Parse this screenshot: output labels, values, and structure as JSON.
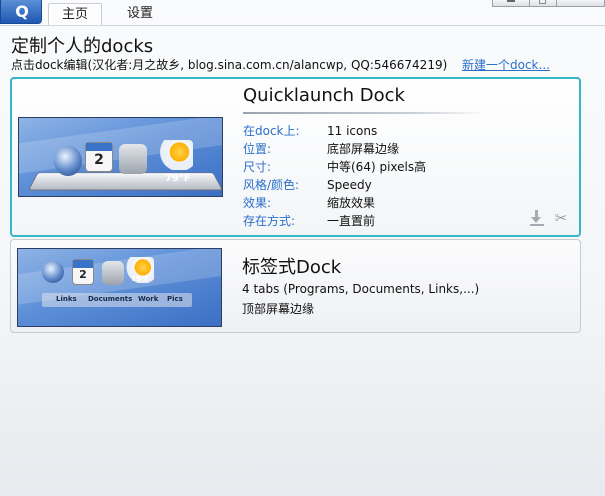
{
  "tabs": [
    {
      "label": "主页",
      "active": true
    },
    {
      "label": "设置",
      "active": false
    }
  ],
  "heading": {
    "title": "定制个人的docks",
    "subtitle": "点击dock编辑(汉化者:月之故乡, blog.sina.com.cn/alancwp, QQ:546674219)",
    "new_dock_link": "新建一个dock..."
  },
  "docks": [
    {
      "name": "Quicklaunch Dock",
      "selected": true,
      "properties": [
        {
          "key": "在dock上:",
          "value": "11 icons"
        },
        {
          "key": "位置:",
          "value": "底部屏幕边缘"
        },
        {
          "key": "尺寸:",
          "value": "中等(64) pixels高"
        },
        {
          "key": "风格/颜色:",
          "value": "Speedy"
        },
        {
          "key": "效果:",
          "value": "缩放效果"
        },
        {
          "key": "存在方式:",
          "value": "一直置前"
        }
      ],
      "preview": {
        "calendar_day": "2",
        "weather_temp": "79°F"
      },
      "actions": {
        "download_icon": "download-icon",
        "remove_icon": "tools-icon"
      }
    },
    {
      "name": "标签式Dock",
      "selected": false,
      "line1": "4 tabs (Programs, Documents, Links,...)",
      "line2": "顶部屏幕边缘",
      "preview": {
        "calendar_day": "2",
        "weather_temp": "79°F",
        "tab_labels": [
          "Links",
          "Documents",
          "Work",
          "Pics"
        ]
      }
    }
  ],
  "colors": {
    "accent": "#35b6c9",
    "link": "#2a6fc9",
    "property_key": "#2a6fc9"
  }
}
